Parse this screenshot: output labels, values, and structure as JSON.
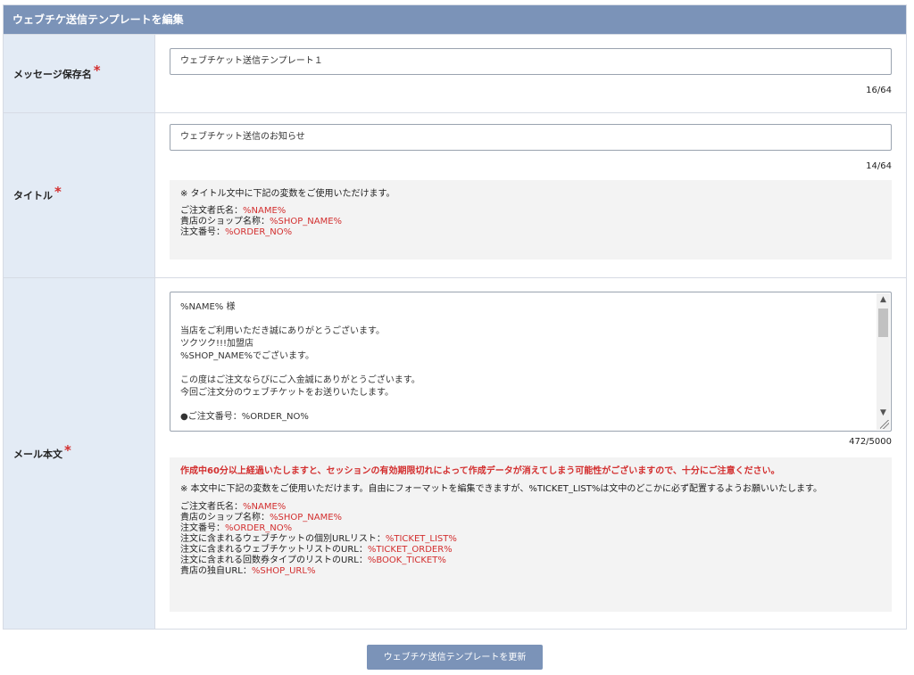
{
  "panel": {
    "title": "ウェブチケ送信テンプレートを編集"
  },
  "fields": {
    "save_name": {
      "label": "メッセージ保存名",
      "required_mark": "*",
      "value": "ウェブチケット送信テンプレート１",
      "counter": "16/64"
    },
    "title": {
      "label": "タイトル",
      "required_mark": "*",
      "value": "ウェブチケット送信のお知らせ",
      "counter": "14/64",
      "notice": {
        "intro": "※ タイトル文中に下記の変数をご使用いただけます。",
        "vars": [
          {
            "label": "ご注文者氏名：",
            "var": "%NAME%"
          },
          {
            "label": "貴店のショップ名称：",
            "var": "%SHOP_NAME%"
          },
          {
            "label": "注文番号：",
            "var": "%ORDER_NO%"
          }
        ]
      }
    },
    "body": {
      "label": "メール本文",
      "required_mark": "*",
      "value": "%NAME% 様\n\n当店をご利用いただき誠にありがとうございます。\nツクツク!!!加盟店\n%SHOP_NAME%でございます。\n\nこの度はご注文ならびにご入金誠にありがとうございます。\n今回ご注文分のウェブチケットをお送りいたします。\n\n●ご注文番号：%ORDER_NO%",
      "counter": "472/5000",
      "notice": {
        "warning": "作成中60分以上経過いたしますと、セッションの有効期限切れによって作成データが消えてしまう可能性がございますので、十分にご注意ください。",
        "intro": "※ 本文中に下記の変数をご使用いただけます。自由にフォーマットを編集できますが、%TICKET_LIST%は文中のどこかに必ず配置するようお願いいたします。",
        "vars": [
          {
            "label": "ご注文者氏名：",
            "var": "%NAME%"
          },
          {
            "label": "貴店のショップ名称：",
            "var": "%SHOP_NAME%"
          },
          {
            "label": "注文番号：",
            "var": "%ORDER_NO%"
          },
          {
            "label": "注文に含まれるウェブチケットの個別URLリスト：",
            "var": "%TICKET_LIST%"
          },
          {
            "label": "注文に含まれるウェブチケットリストのURL：",
            "var": "%TICKET_ORDER%"
          },
          {
            "label": "注文に含まれる回数券タイプのリストのURL：",
            "var": "%BOOK_TICKET%"
          },
          {
            "label": "貴店の独自URL：",
            "var": "%SHOP_URL%"
          }
        ]
      }
    }
  },
  "submit_label": "ウェブチケ送信テンプレートを更新",
  "colors": {
    "header": "#7b93b8",
    "label_bg": "#e3ebf5",
    "required": "#d32f2f",
    "variable": "#d32f2f"
  }
}
